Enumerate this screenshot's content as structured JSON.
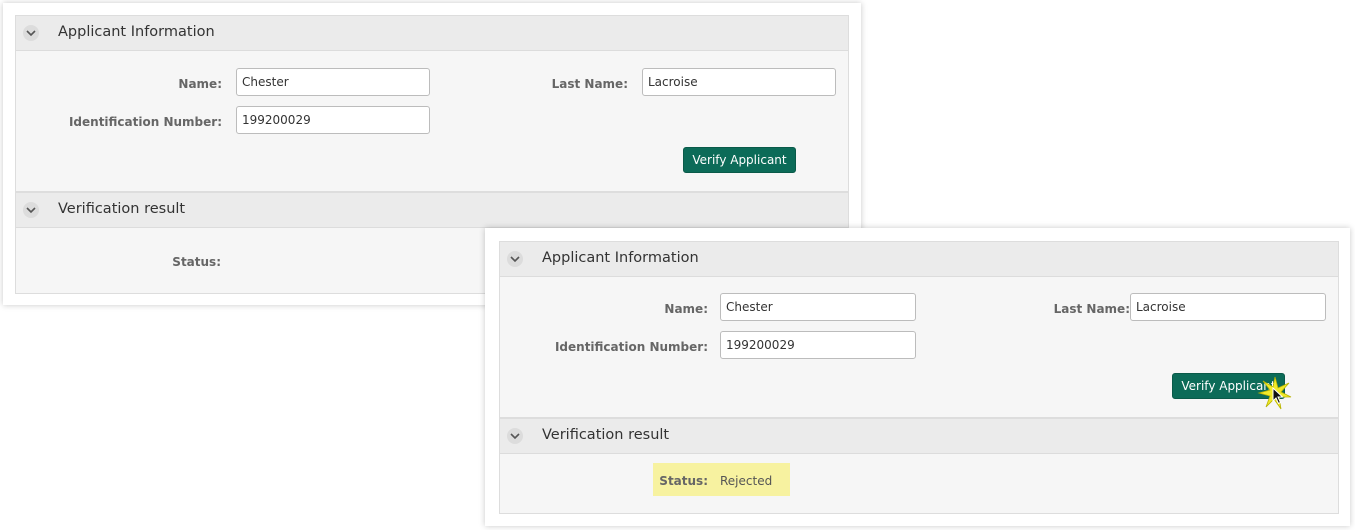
{
  "before": {
    "applicant_panel": {
      "title": "Applicant Information",
      "name_label": "Name:",
      "name_value": "Chester",
      "last_name_label": "Last Name:",
      "last_name_value": "Lacroise",
      "id_label": "Identification Number:",
      "id_value": "199200029",
      "verify_button": "Verify Applicant"
    },
    "result_panel": {
      "title": "Verification result",
      "status_label": "Status:",
      "status_value": ""
    }
  },
  "after": {
    "applicant_panel": {
      "title": "Applicant Information",
      "name_label": "Name:",
      "name_value": "Chester",
      "last_name_label": "Last Name:",
      "last_name_value": "Lacroise",
      "id_label": "Identification Number:",
      "id_value": "199200029",
      "verify_button": "Verify Applicant"
    },
    "result_panel": {
      "title": "Verification result",
      "status_label": "Status:",
      "status_value": "Rejected"
    }
  },
  "colors": {
    "button": "#0c6b58",
    "status_highlight": "#f7f2a0",
    "header": "#ebebeb"
  }
}
